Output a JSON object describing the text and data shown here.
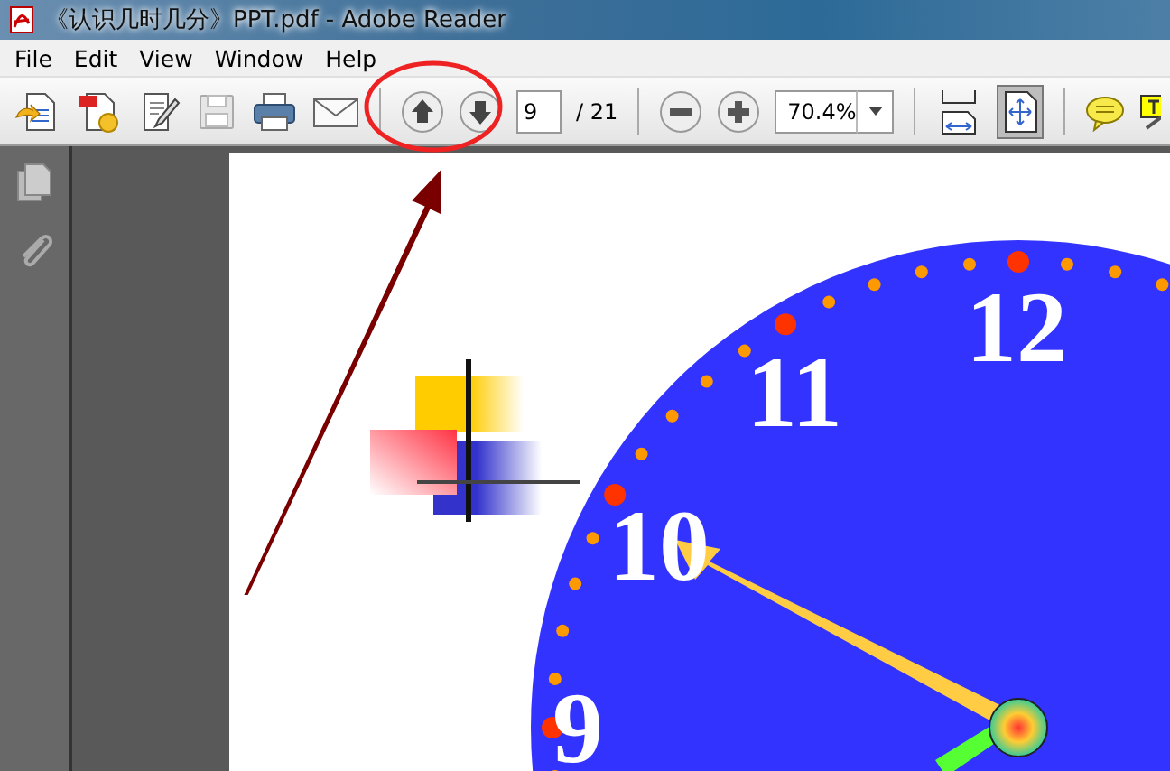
{
  "window": {
    "title": "《认识几时几分》PPT.pdf - Adobe Reader"
  },
  "menu": [
    {
      "label": "File"
    },
    {
      "label": "Edit"
    },
    {
      "label": "View"
    },
    {
      "label": "Window"
    },
    {
      "label": "Help"
    }
  ],
  "toolbar": {
    "page_field": {
      "value": "9"
    },
    "page_count": "/ 21",
    "zoom_field": {
      "value": "70.4%"
    },
    "view_buttons": [
      {
        "kind": "fit-width",
        "selected": false
      },
      {
        "kind": "fit-page",
        "selected": true
      }
    ]
  },
  "document": {
    "clock_numerals": [
      {
        "label": "12"
      },
      {
        "label": "11"
      },
      {
        "label": "10"
      },
      {
        "label": "9"
      }
    ]
  }
}
